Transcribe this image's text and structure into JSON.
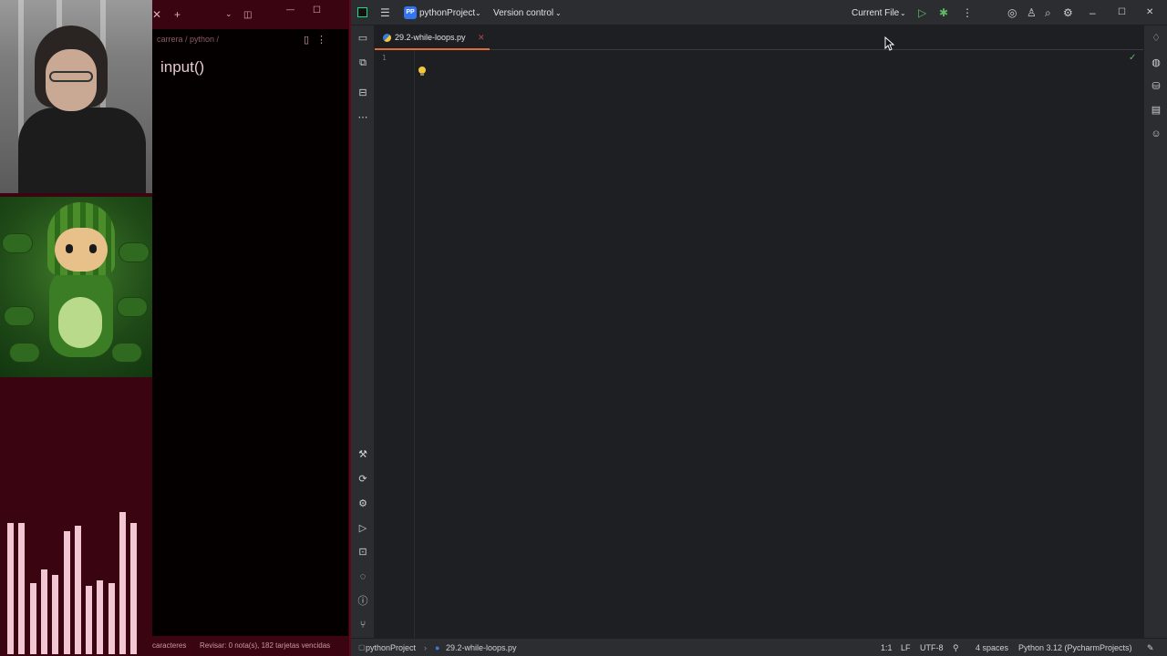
{
  "notes": {
    "breadcrumb": "carrera / python /",
    "title": "input()",
    "status_chars": "caracteres",
    "status_review": "Revisar: 0 nota(s), 182 tarjetas vencidas"
  },
  "ide": {
    "project_name": "pythonProject",
    "project_badge": "PP",
    "version_control": "Version control",
    "run_config": "Current File",
    "tab_name": "29.2-while-loops.py",
    "line_number": "1",
    "status": {
      "project": "pythonProject",
      "file": "29.2-while-loops.py",
      "position": "1:1",
      "line_ending": "LF",
      "encoding": "UTF-8",
      "indent": "4 spaces",
      "interpreter": "Python 3.12 (PycharmProjects)"
    }
  },
  "visualizer": {
    "levels": [
      0.48,
      0.48,
      0.26,
      0.31,
      0.29,
      0.45,
      0.47,
      0.25,
      0.27,
      0.26,
      0.52,
      0.48
    ]
  },
  "colors": {
    "accent_tab": "#e06c3d",
    "run_green": "#5fb865",
    "notes_bg": "#3a0510",
    "viz_bar": "#f2c6d2"
  }
}
